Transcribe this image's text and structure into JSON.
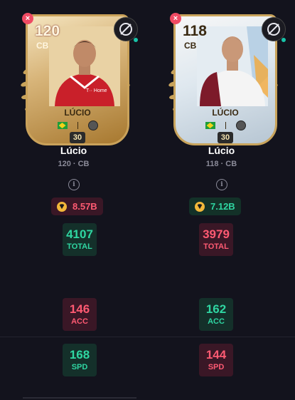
{
  "left": {
    "card": {
      "rating": "120",
      "position": "CB",
      "name": "LÚCIO",
      "level": "30",
      "club_text": "T·· Home"
    },
    "name": "Lúcio",
    "subtitle": "120 · CB",
    "price": "8.57B",
    "stats": [
      {
        "value": "4107",
        "label": "TOTAL"
      },
      {
        "value": "146",
        "label": "ACC"
      },
      {
        "value": "168",
        "label": "SPD"
      }
    ]
  },
  "right": {
    "card": {
      "rating": "118",
      "position": "CB",
      "name": "LÚCIO",
      "level": "30"
    },
    "name": "Lúcio",
    "subtitle": "118 · CB",
    "price": "7.12B",
    "stats": [
      {
        "value": "3979",
        "label": "TOTAL"
      },
      {
        "value": "162",
        "label": "ACC"
      },
      {
        "value": "144",
        "label": "SPD"
      }
    ]
  },
  "icons": {
    "remove": "×",
    "info": "i"
  },
  "colors": {
    "background": "#13131d",
    "better": "#2fd6a2",
    "worse": "#ff5a72"
  }
}
